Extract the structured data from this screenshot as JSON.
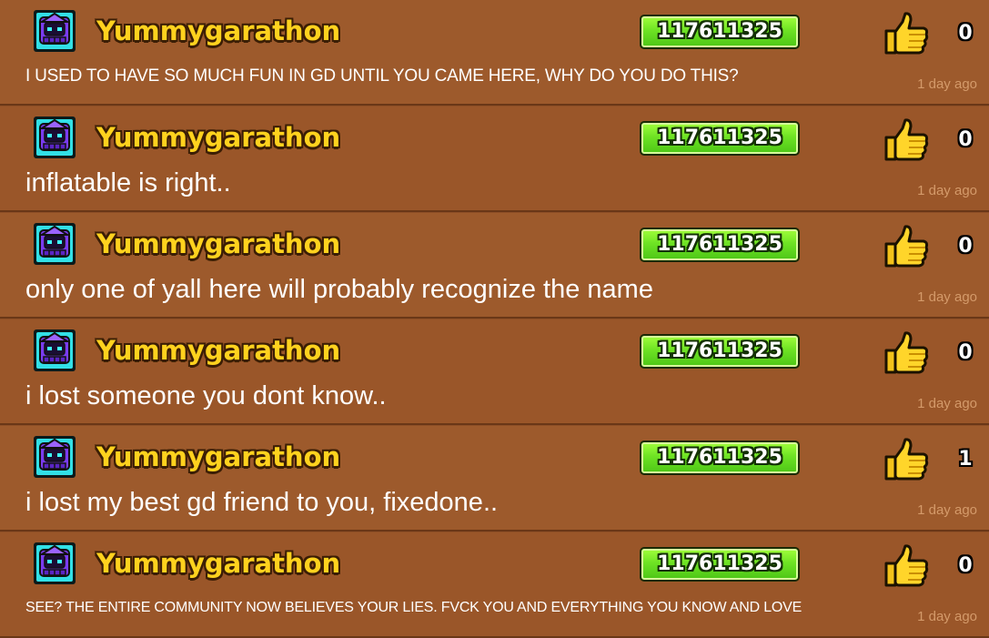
{
  "comments": [
    {
      "username": "Yummygarathon",
      "player_id": "117611325",
      "likes": "0",
      "text": "I USED TO HAVE SO MUCH FUN IN GD UNTIL YOU CAME HERE, WHY DO YOU DO THIS?",
      "time": "1 day ago"
    },
    {
      "username": "Yummygarathon",
      "player_id": "117611325",
      "likes": "0",
      "text": "inflatable is right..",
      "time": "1 day ago"
    },
    {
      "username": "Yummygarathon",
      "player_id": "117611325",
      "likes": "0",
      "text": "only one of yall here will probably recognize the name",
      "time": "1 day ago"
    },
    {
      "username": "Yummygarathon",
      "player_id": "117611325",
      "likes": "0",
      "text": "i lost someone you dont know..",
      "time": "1 day ago"
    },
    {
      "username": "Yummygarathon",
      "player_id": "117611325",
      "likes": "1",
      "text": "i lost my best gd friend to you, fixedone..",
      "time": "1 day ago"
    },
    {
      "username": "Yummygarathon",
      "player_id": "117611325",
      "likes": "0",
      "text": "SEE? THE ENTIRE COMMUNITY NOW BELIEVES YOUR LIES. FVCK YOU AND EVERYTHING YOU KNOW AND LOVE",
      "time": "1 day ago"
    }
  ],
  "icons": {
    "player_icon": "knight-player-icon",
    "like": "thumbs-up-icon"
  },
  "colors": {
    "background": "#9d5a2c",
    "username": "#ffd21e",
    "badge": "#6ee324",
    "time": "#d49a6a"
  }
}
